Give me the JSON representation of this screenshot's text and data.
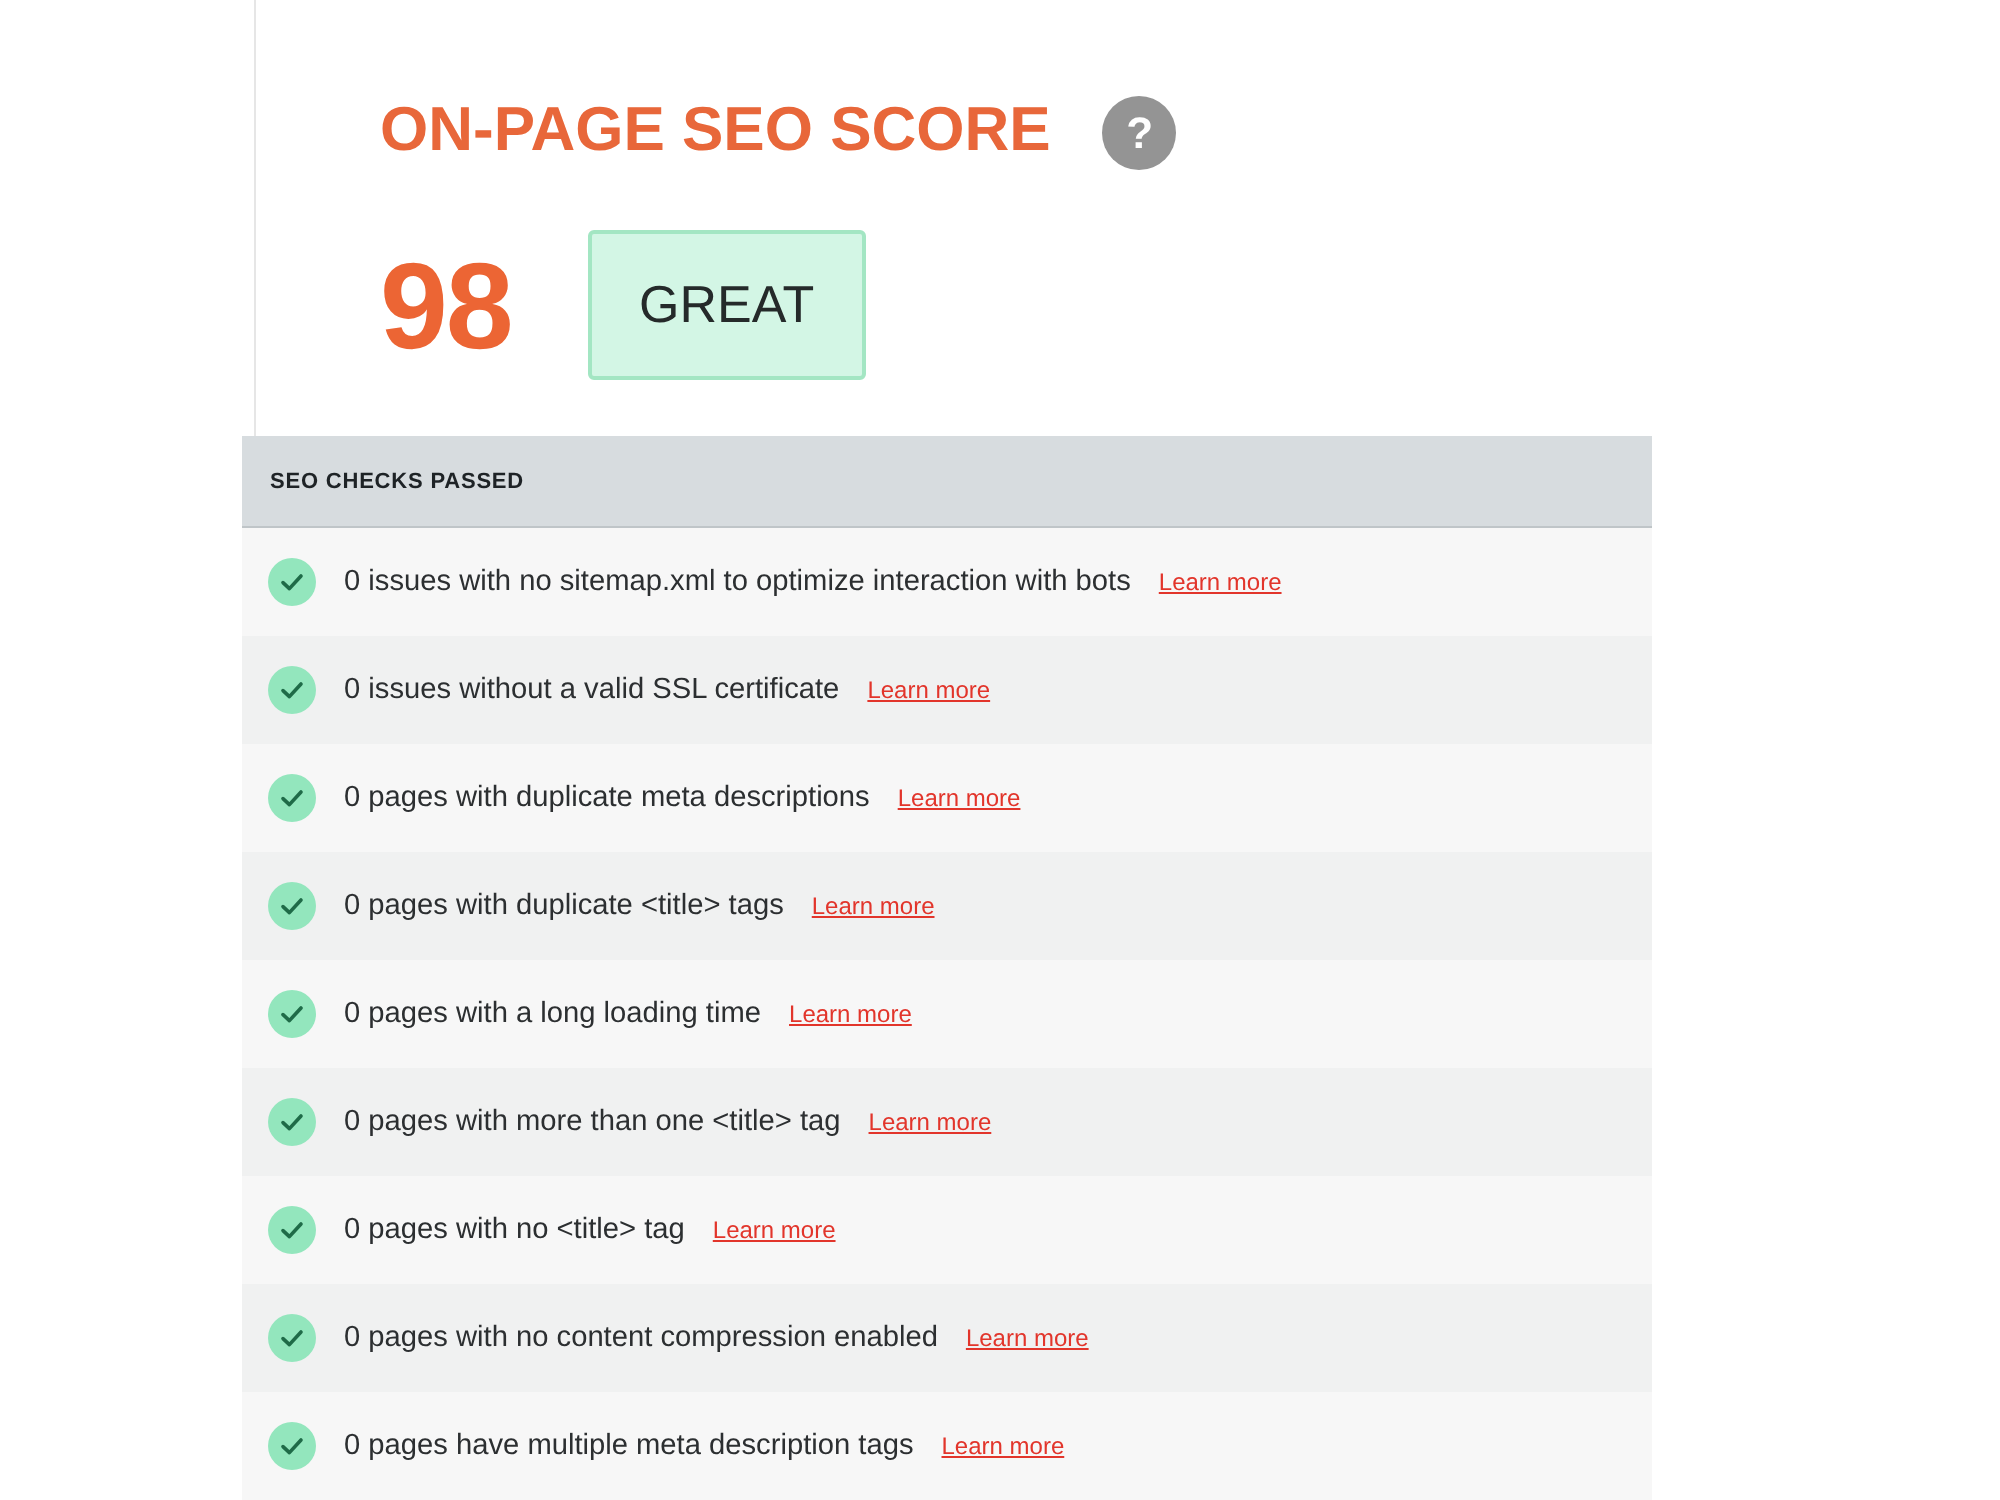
{
  "score_panel": {
    "title": "ON-PAGE SEO SCORE",
    "help_icon": "?",
    "score": "98",
    "rating": "GREAT"
  },
  "checks_section": {
    "heading": "SEO CHECKS PASSED",
    "checks": [
      {
        "text": "0 issues with no sitemap.xml to optimize interaction with bots",
        "link": "Learn more"
      },
      {
        "text": "0 issues without a valid SSL certificate",
        "link": "Learn more"
      },
      {
        "text": "0 pages with duplicate meta descriptions",
        "link": "Learn more"
      },
      {
        "text": "0 pages with duplicate <title> tags",
        "link": "Learn more"
      },
      {
        "text": "0 pages with a long loading time",
        "link": "Learn more"
      },
      {
        "text": "0 pages with more than one <title> tag",
        "link": "Learn more"
      },
      {
        "text": "0 pages with no <title> tag",
        "link": "Learn more"
      },
      {
        "text": "0 pages with no content compression enabled",
        "link": "Learn more"
      },
      {
        "text": "0 pages have multiple meta description tags",
        "link": "Learn more"
      }
    ]
  }
}
